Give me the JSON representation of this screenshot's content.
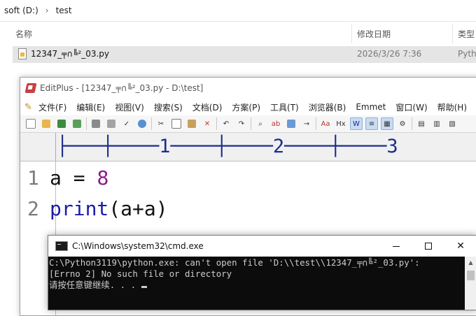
{
  "explorer": {
    "breadcrumb": {
      "drive": "soft (D:)",
      "sep": "›",
      "folder": "test"
    },
    "columns": {
      "name": "名称",
      "modified": "修改日期",
      "type": "类型"
    },
    "file": {
      "name": "12347_╤∩╚²_03.py",
      "modified": "2026/3/26 7:36",
      "type": "Pytho"
    }
  },
  "editplus": {
    "title": "EditPlus - [12347_╤∩╚²_03.py - D:\\test]",
    "menu": [
      "文件(F)",
      "编辑(E)",
      "视图(V)",
      "搜索(S)",
      "文档(D)",
      "方案(P)",
      "工具(T)",
      "浏览器(B)",
      "Emmet",
      "窗口(W)",
      "帮助(H)"
    ],
    "ruler": "├───┼────1────┼────2────┼────3",
    "code": [
      {
        "line_no": "1",
        "tokens": [
          "a",
          " = ",
          "8"
        ]
      },
      {
        "line_no": "2",
        "tokens": [
          "print",
          "(a+a)"
        ]
      }
    ]
  },
  "cmd": {
    "title": "C:\\Windows\\system32\\cmd.exe",
    "close_glyph": "✕",
    "lines": [
      "C:\\Python3119\\python.exe: can't open file 'D:\\\\test\\\\12347_╤∩╚²_03.py':",
      "[Errno 2] No such file or directory",
      "请按任意键继续. . . "
    ]
  },
  "toolbar_icons": [
    "new-file-icon",
    "open-folder-icon",
    "save-icon",
    "save-all-icon",
    "print-icon",
    "print-preview-icon",
    "spell-check-icon",
    "browser-preview-icon",
    "cut-icon",
    "copy-icon",
    "paste-icon",
    "delete-icon",
    "undo-icon",
    "redo-icon",
    "find-icon",
    "replace-icon",
    "find-in-files-icon",
    "goto-icon",
    "font-icon",
    "hex-icon",
    "word-wrap-icon",
    "line-number-icon",
    "column-icon",
    "settings-icon",
    "panel-icon",
    "cliptext-icon",
    "html-toolbar-icon"
  ],
  "colors": {
    "accent": "#1d2f8a",
    "keyword": "#1b1ba8",
    "number": "#8b1d8b",
    "console_bg": "#0c0c0c",
    "console_fg": "#cccccc"
  }
}
